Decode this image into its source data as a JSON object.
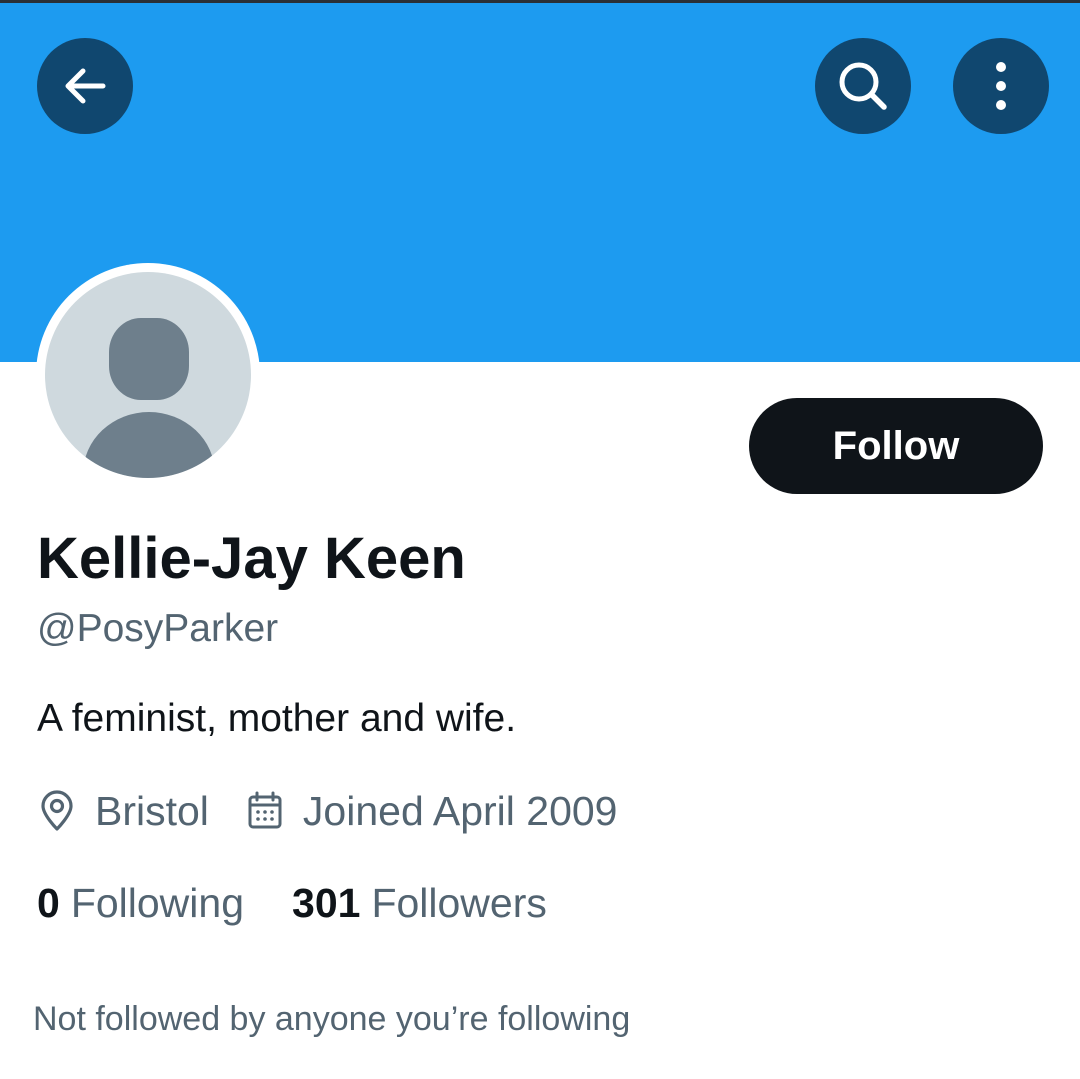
{
  "header": {
    "banner_color": "#1d9bf0",
    "button_color": "#10476f",
    "back_icon": "arrow-left-icon",
    "search_icon": "search-icon",
    "more_icon": "more-vertical-icon"
  },
  "profile": {
    "display_name": "Kellie-Jay Keen",
    "handle": "@PosyParker",
    "bio": "A feminist, mother and wife.",
    "location": "Bristol",
    "joined": "Joined April 2009",
    "location_icon": "location-pin-icon",
    "calendar_icon": "calendar-icon",
    "avatar": "default-avatar"
  },
  "actions": {
    "follow_label": "Follow"
  },
  "stats": {
    "following_count": "0",
    "following_label": "Following",
    "followers_count": "301",
    "followers_label": "Followers"
  },
  "social_context": {
    "text": "Not followed by anyone you’re following"
  },
  "colors": {
    "primary_text": "#0f1419",
    "secondary_text": "#536471",
    "follow_button_bg": "#0f1419"
  }
}
